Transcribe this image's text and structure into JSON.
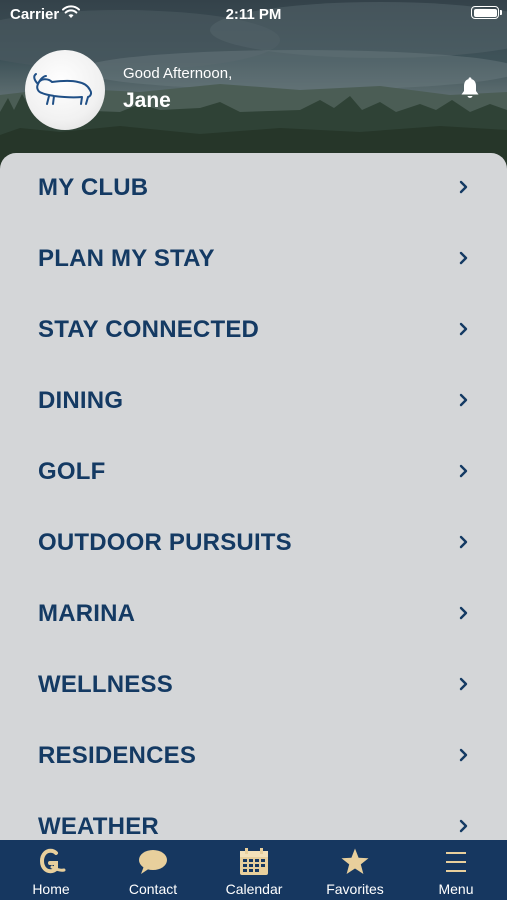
{
  "status_bar": {
    "carrier": "Carrier",
    "time": "2:11 PM"
  },
  "header": {
    "greeting": "Good Afternoon,",
    "user_name": "Jane"
  },
  "colors": {
    "menu_text": "#143a63",
    "tab_bar": "#163760",
    "tab_icon": "#e8cf9c",
    "panel_bg": "#d4d6d8"
  },
  "menu": {
    "items": [
      {
        "label": "MY CLUB"
      },
      {
        "label": "PLAN MY STAY"
      },
      {
        "label": "STAY CONNECTED"
      },
      {
        "label": "DINING"
      },
      {
        "label": "GOLF"
      },
      {
        "label": "OUTDOOR PURSUITS"
      },
      {
        "label": "MARINA"
      },
      {
        "label": "WELLNESS"
      },
      {
        "label": "RESIDENCES"
      },
      {
        "label": "WEATHER"
      }
    ]
  },
  "tab_bar": {
    "tabs": [
      {
        "label": "Home",
        "icon": "club-logo-icon"
      },
      {
        "label": "Contact",
        "icon": "chat-bubble-icon"
      },
      {
        "label": "Calendar",
        "icon": "calendar-icon"
      },
      {
        "label": "Favorites",
        "icon": "star-icon"
      },
      {
        "label": "Menu",
        "icon": "hamburger-icon"
      }
    ]
  }
}
